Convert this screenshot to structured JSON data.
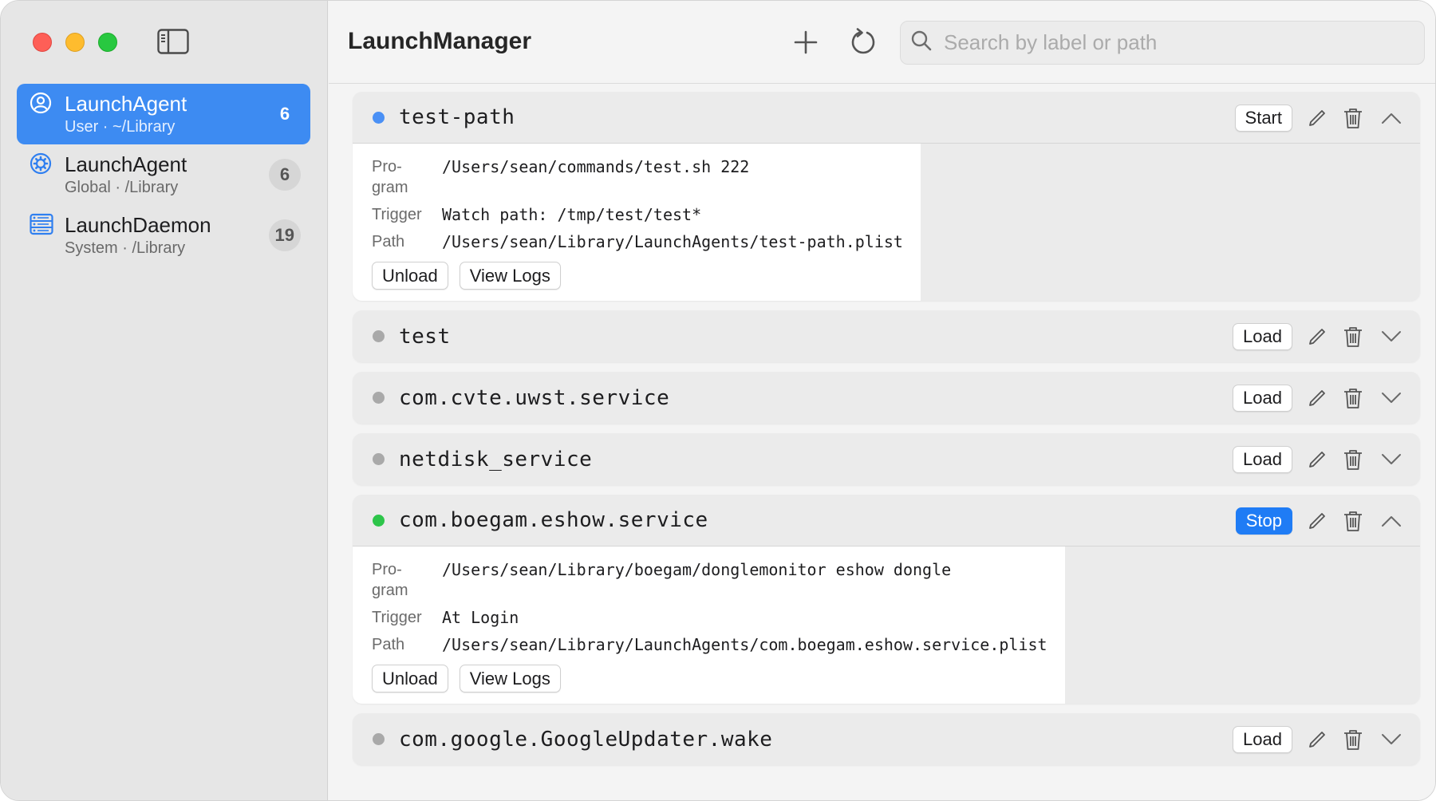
{
  "window": {
    "controls": [
      "close",
      "minimize",
      "zoom"
    ]
  },
  "sidebar": {
    "items": [
      {
        "title": "LaunchAgent",
        "subtitle": "User · ~/Library",
        "count": "6",
        "icon": "user-circle-icon",
        "active": true
      },
      {
        "title": "LaunchAgent",
        "subtitle": "Global · /Library",
        "count": "6",
        "icon": "gear-circle-icon",
        "active": false
      },
      {
        "title": "LaunchDaemon",
        "subtitle": "System · /Library",
        "count": "19",
        "icon": "server-rack-icon",
        "active": false
      }
    ]
  },
  "toolbar": {
    "title": "LaunchManager",
    "add_icon": "plus-icon",
    "refresh_icon": "refresh-icon",
    "search": {
      "placeholder": "Search by label or path",
      "value": ""
    }
  },
  "colors": {
    "accent": "#1f7cf5",
    "sidebar_selected": "#3d8bf2",
    "status_loaded": "#4a90f5",
    "status_running": "#2dc54a",
    "status_unloaded": "#a9a9a9"
  },
  "jobs": [
    {
      "label": "test-path",
      "status": "loaded",
      "action": "Start",
      "expanded": true,
      "details": {
        "program_key": "Pro-\ngram",
        "program": "/Users/sean/commands/test.sh 222",
        "trigger_key": "Trigger",
        "trigger": "Watch path: /tmp/test/test*",
        "path_key": "Path",
        "path": "/Users/sean/Library/LaunchAgents/test-path.plist",
        "unload_label": "Unload",
        "logs_label": "View Logs"
      }
    },
    {
      "label": "test",
      "status": "unloaded",
      "action": "Load",
      "expanded": false
    },
    {
      "label": "com.cvte.uwst.service",
      "status": "unloaded",
      "action": "Load",
      "expanded": false
    },
    {
      "label": "netdisk_service",
      "status": "unloaded",
      "action": "Load",
      "expanded": false
    },
    {
      "label": "com.boegam.eshow.service",
      "status": "running",
      "action": "Stop",
      "expanded": true,
      "details": {
        "program_key": "Pro-\ngram",
        "program": "/Users/sean/Library/boegam/donglemonitor eshow dongle",
        "trigger_key": "Trigger",
        "trigger": "At Login",
        "path_key": "Path",
        "path": "/Users/sean/Library/LaunchAgents/com.boegam.eshow.service.plist",
        "unload_label": "Unload",
        "logs_label": "View Logs"
      }
    },
    {
      "label": "com.google.GoogleUpdater.wake",
      "status": "unloaded",
      "action": "Load",
      "expanded": false
    }
  ]
}
